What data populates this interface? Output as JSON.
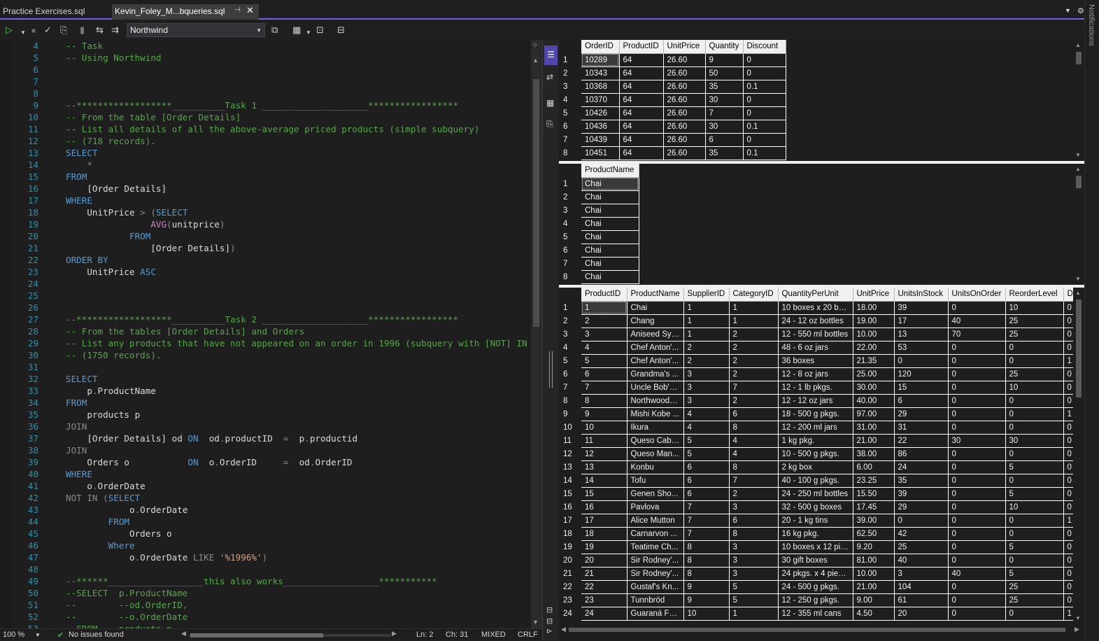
{
  "tabs": [
    {
      "label": "Practice Exercises.sql",
      "active": false
    },
    {
      "label": "Kevin_Foley_M...bqueries.sql",
      "active": true
    }
  ],
  "notifications_label": "Notifications",
  "toolbar": {
    "database": "Northwind"
  },
  "editor": {
    "lines": [
      {
        "n": "4",
        "segs": [
          [
            "c",
            "-- Task"
          ]
        ]
      },
      {
        "n": "5",
        "segs": [
          [
            "c",
            "-- Using Northwind"
          ]
        ]
      },
      {
        "n": "6",
        "segs": []
      },
      {
        "n": "7",
        "segs": []
      },
      {
        "n": "8",
        "segs": []
      },
      {
        "n": "9",
        "segs": [
          [
            "c",
            "--******************__________Task 1 ____________________*****************"
          ]
        ]
      },
      {
        "n": "10",
        "segs": [
          [
            "c",
            "-- From the table [Order Details]"
          ]
        ]
      },
      {
        "n": "11",
        "segs": [
          [
            "c",
            "-- List all details of all the above-average priced products (simple subquery)"
          ]
        ]
      },
      {
        "n": "12",
        "segs": [
          [
            "c",
            "-- (718 records)."
          ]
        ]
      },
      {
        "n": "13",
        "segs": [
          [
            "k",
            "SELECT"
          ]
        ]
      },
      {
        "n": "14",
        "segs": [
          [
            "t",
            "    "
          ],
          [
            "g",
            "*"
          ]
        ]
      },
      {
        "n": "15",
        "segs": [
          [
            "k",
            "FROM"
          ]
        ]
      },
      {
        "n": "16",
        "segs": [
          [
            "t",
            "    [Order Details]"
          ]
        ]
      },
      {
        "n": "17",
        "segs": [
          [
            "k",
            "WHERE"
          ]
        ]
      },
      {
        "n": "18",
        "segs": [
          [
            "t",
            "    UnitPrice "
          ],
          [
            "g",
            "> ("
          ],
          [
            "k",
            "SELECT"
          ]
        ]
      },
      {
        "n": "19",
        "segs": [
          [
            "t",
            "                "
          ],
          [
            "f",
            "AVG"
          ],
          [
            "g",
            "("
          ],
          [
            "t",
            "unitprice"
          ],
          [
            "g",
            ")"
          ]
        ]
      },
      {
        "n": "20",
        "segs": [
          [
            "t",
            "            "
          ],
          [
            "k",
            "FROM"
          ]
        ]
      },
      {
        "n": "21",
        "segs": [
          [
            "t",
            "                [Order Details]"
          ],
          [
            "g",
            ")"
          ]
        ]
      },
      {
        "n": "22",
        "segs": [
          [
            "k",
            "ORDER BY"
          ]
        ]
      },
      {
        "n": "23",
        "segs": [
          [
            "t",
            "    UnitPrice "
          ],
          [
            "k",
            "ASC"
          ]
        ]
      },
      {
        "n": "24",
        "segs": []
      },
      {
        "n": "25",
        "segs": []
      },
      {
        "n": "26",
        "segs": []
      },
      {
        "n": "27",
        "segs": [
          [
            "c",
            "--******************__________Task 2 ____________________*****************"
          ]
        ]
      },
      {
        "n": "28",
        "segs": [
          [
            "c",
            "-- From the tables [Order Details] and Orders"
          ]
        ]
      },
      {
        "n": "29",
        "segs": [
          [
            "c",
            "-- List any products that have not appeared on an order in 1996 (subquery with [NOT] IN"
          ]
        ]
      },
      {
        "n": "30",
        "segs": [
          [
            "c",
            "-- (1750 records)."
          ]
        ]
      },
      {
        "n": "31",
        "segs": []
      },
      {
        "n": "32",
        "segs": [
          [
            "k",
            "SELECT"
          ]
        ]
      },
      {
        "n": "33",
        "segs": [
          [
            "t",
            "    p"
          ],
          [
            "g",
            "."
          ],
          [
            "t",
            "ProductName"
          ]
        ]
      },
      {
        "n": "34",
        "segs": [
          [
            "k",
            "FROM"
          ]
        ]
      },
      {
        "n": "35",
        "segs": [
          [
            "t",
            "    products p"
          ]
        ]
      },
      {
        "n": "36",
        "segs": [
          [
            "g",
            "JOIN"
          ]
        ]
      },
      {
        "n": "37",
        "segs": [
          [
            "t",
            "    [Order Details] od "
          ],
          [
            "k",
            "ON"
          ],
          [
            "t",
            "  od"
          ],
          [
            "g",
            "."
          ],
          [
            "t",
            "productID  "
          ],
          [
            "g",
            "="
          ],
          [
            "t",
            "  p"
          ],
          [
            "g",
            "."
          ],
          [
            "t",
            "productid"
          ]
        ]
      },
      {
        "n": "38",
        "segs": [
          [
            "g",
            "JOIN"
          ]
        ]
      },
      {
        "n": "39",
        "segs": [
          [
            "t",
            "    Orders o           "
          ],
          [
            "k",
            "ON"
          ],
          [
            "t",
            "  o"
          ],
          [
            "g",
            "."
          ],
          [
            "t",
            "OrderID     "
          ],
          [
            "g",
            "="
          ],
          [
            "t",
            "  od"
          ],
          [
            "g",
            "."
          ],
          [
            "t",
            "OrderID"
          ]
        ]
      },
      {
        "n": "40",
        "segs": [
          [
            "k",
            "WHERE"
          ]
        ]
      },
      {
        "n": "41",
        "segs": [
          [
            "t",
            "    o"
          ],
          [
            "g",
            "."
          ],
          [
            "t",
            "OrderDate"
          ]
        ]
      },
      {
        "n": "42",
        "segs": [
          [
            "g",
            "NOT IN ("
          ],
          [
            "k",
            "SELECT"
          ]
        ]
      },
      {
        "n": "43",
        "segs": [
          [
            "t",
            "            o"
          ],
          [
            "g",
            "."
          ],
          [
            "t",
            "OrderDate"
          ]
        ]
      },
      {
        "n": "44",
        "segs": [
          [
            "t",
            "        "
          ],
          [
            "k",
            "FROM"
          ]
        ]
      },
      {
        "n": "45",
        "segs": [
          [
            "t",
            "            Orders o"
          ]
        ]
      },
      {
        "n": "46",
        "segs": [
          [
            "t",
            "        "
          ],
          [
            "k",
            "Where"
          ]
        ]
      },
      {
        "n": "47",
        "segs": [
          [
            "t",
            "            o"
          ],
          [
            "g",
            "."
          ],
          [
            "t",
            "OrderDate "
          ],
          [
            "g",
            "LIKE "
          ],
          [
            "s",
            "'%1996%'"
          ],
          [
            "g",
            ")"
          ]
        ]
      },
      {
        "n": "48",
        "segs": []
      },
      {
        "n": "49",
        "segs": [
          [
            "c",
            "--******__________________this also works__________________***********"
          ]
        ]
      },
      {
        "n": "50",
        "segs": [
          [
            "c",
            "--SELECT  p.ProductName"
          ]
        ]
      },
      {
        "n": "51",
        "segs": [
          [
            "c",
            "--        --od.OrderID,"
          ]
        ]
      },
      {
        "n": "52",
        "segs": [
          [
            "c",
            "--        --o.OrderDate"
          ]
        ]
      },
      {
        "n": "53",
        "segs": [
          [
            "c",
            "--FROM    products p"
          ]
        ]
      }
    ]
  },
  "statusbar": {
    "zoom": "100 %",
    "issues": "No issues found",
    "ln": "Ln: 2",
    "ch": "Ch: 31",
    "mixed": "MIXED",
    "crlf": "CRLF"
  },
  "grid1": {
    "columns": [
      "OrderID",
      "ProductID",
      "UnitPrice",
      "Quantity",
      "Discount"
    ],
    "rows": [
      [
        "10289",
        "64",
        "26.60",
        "9",
        "0"
      ],
      [
        "10343",
        "64",
        "26.60",
        "50",
        "0"
      ],
      [
        "10368",
        "64",
        "26.60",
        "35",
        "0.1"
      ],
      [
        "10370",
        "64",
        "26.60",
        "30",
        "0"
      ],
      [
        "10426",
        "64",
        "26.60",
        "7",
        "0"
      ],
      [
        "10436",
        "64",
        "26.60",
        "30",
        "0.1"
      ],
      [
        "10439",
        "64",
        "26.60",
        "6",
        "0"
      ],
      [
        "10451",
        "64",
        "26.60",
        "35",
        "0.1"
      ]
    ]
  },
  "grid2": {
    "columns": [
      "ProductName"
    ],
    "rows": [
      [
        "Chai"
      ],
      [
        "Chai"
      ],
      [
        "Chai"
      ],
      [
        "Chai"
      ],
      [
        "Chai"
      ],
      [
        "Chai"
      ],
      [
        "Chai"
      ],
      [
        "Chai"
      ]
    ]
  },
  "grid3": {
    "columns": [
      "ProductID",
      "ProductName",
      "SupplierID",
      "CategoryID",
      "QuantityPerUnit",
      "UnitPrice",
      "UnitsInStock",
      "UnitsOnOrder",
      "ReorderLevel",
      "Dis"
    ],
    "rows": [
      [
        "1",
        "Chai",
        "1",
        "1",
        "10 boxes x 20 bags",
        "18.00",
        "39",
        "0",
        "10",
        "0"
      ],
      [
        "2",
        "Chang",
        "1",
        "1",
        "24 - 12 oz bottles",
        "19.00",
        "17",
        "40",
        "25",
        "0"
      ],
      [
        "3",
        "Aniseed Syr...",
        "1",
        "2",
        "12 - 550 ml bottles",
        "10.00",
        "13",
        "70",
        "25",
        "0"
      ],
      [
        "4",
        "Chef Anton'...",
        "2",
        "2",
        "48 - 6 oz jars",
        "22.00",
        "53",
        "0",
        "0",
        "0"
      ],
      [
        "5",
        "Chef Anton'...",
        "2",
        "2",
        "36 boxes",
        "21.35",
        "0",
        "0",
        "0",
        "1"
      ],
      [
        "6",
        "Grandma's ...",
        "3",
        "2",
        "12 - 8 oz jars",
        "25.00",
        "120",
        "0",
        "25",
        "0"
      ],
      [
        "7",
        "Uncle Bob's...",
        "3",
        "7",
        "12 - 1 lb pkgs.",
        "30.00",
        "15",
        "0",
        "10",
        "0"
      ],
      [
        "8",
        "Northwoods...",
        "3",
        "2",
        "12 - 12 oz jars",
        "40.00",
        "6",
        "0",
        "0",
        "0"
      ],
      [
        "9",
        "Mishi Kobe ...",
        "4",
        "6",
        "18 - 500 g pkgs.",
        "97.00",
        "29",
        "0",
        "0",
        "1"
      ],
      [
        "10",
        "Ikura",
        "4",
        "8",
        "12 - 200 ml jars",
        "31.00",
        "31",
        "0",
        "0",
        "0"
      ],
      [
        "11",
        "Queso Cabr...",
        "5",
        "4",
        "1 kg pkg.",
        "21.00",
        "22",
        "30",
        "30",
        "0"
      ],
      [
        "12",
        "Queso Man...",
        "5",
        "4",
        "10 - 500 g pkgs.",
        "38.00",
        "86",
        "0",
        "0",
        "0"
      ],
      [
        "13",
        "Konbu",
        "6",
        "8",
        "2 kg box",
        "6.00",
        "24",
        "0",
        "5",
        "0"
      ],
      [
        "14",
        "Tofu",
        "6",
        "7",
        "40 - 100 g pkgs.",
        "23.25",
        "35",
        "0",
        "0",
        "0"
      ],
      [
        "15",
        "Genen Sho...",
        "6",
        "2",
        "24 - 250 ml bottles",
        "15.50",
        "39",
        "0",
        "5",
        "0"
      ],
      [
        "16",
        "Pavlova",
        "7",
        "3",
        "32 - 500 g boxes",
        "17.45",
        "29",
        "0",
        "10",
        "0"
      ],
      [
        "17",
        "Alice Mutton",
        "7",
        "6",
        "20 - 1 kg tins",
        "39.00",
        "0",
        "0",
        "0",
        "1"
      ],
      [
        "18",
        "Carnarvon ...",
        "7",
        "8",
        "16 kg pkg.",
        "62.50",
        "42",
        "0",
        "0",
        "0"
      ],
      [
        "19",
        "Teatime Ch...",
        "8",
        "3",
        "10 boxes x 12 pie...",
        "9.20",
        "25",
        "0",
        "5",
        "0"
      ],
      [
        "20",
        "Sir Rodney'...",
        "8",
        "3",
        "30 gift boxes",
        "81.00",
        "40",
        "0",
        "0",
        "0"
      ],
      [
        "21",
        "Sir Rodney'...",
        "8",
        "3",
        "24 pkgs. x 4 pieces",
        "10.00",
        "3",
        "40",
        "5",
        "0"
      ],
      [
        "22",
        "Gustaf's Kn...",
        "9",
        "5",
        "24 - 500 g pkgs.",
        "21.00",
        "104",
        "0",
        "25",
        "0"
      ],
      [
        "23",
        "Tunnbröd",
        "9",
        "5",
        "12 - 250 g pkgs.",
        "9.00",
        "61",
        "0",
        "25",
        "0"
      ],
      [
        "24",
        "Guaraná Fa...",
        "10",
        "1",
        "12 - 355 ml cans",
        "4.50",
        "20",
        "0",
        "0",
        "1"
      ]
    ]
  }
}
